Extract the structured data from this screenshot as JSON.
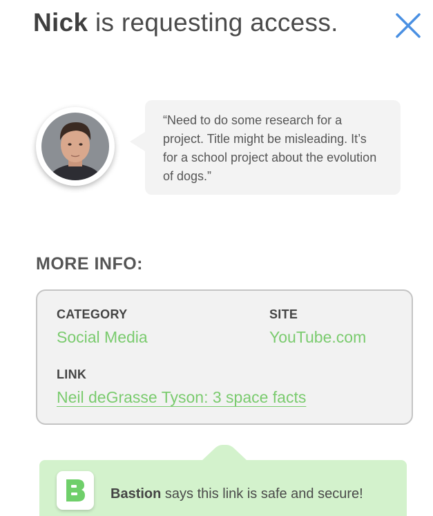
{
  "header": {
    "requester_name": "Nick",
    "title_suffix": " is requesting access."
  },
  "request": {
    "message": "“Need to do some research for a project. Title might be misleading. It’s for a school project about the evolution of dogs.”"
  },
  "more_info": {
    "heading": "MORE INFO:",
    "category_label": "CATEGORY",
    "category_value": "Social Media",
    "site_label": "SITE",
    "site_value": "YouTube.com",
    "link_label": "LINK",
    "link_value": "Neil deGrasse Tyson: 3 space facts"
  },
  "safety": {
    "brand": "Bastion",
    "message": " says this link is safe and secure!"
  },
  "icons": {
    "close": "close-icon",
    "logo": "bastion-logo-icon"
  },
  "colors": {
    "accent_green": "#7acb6e",
    "banner_green": "#d3f2cc",
    "close_blue": "#4a90e2",
    "bubble_gray": "#f3f3f3",
    "text_gray": "#4a4a4a"
  }
}
